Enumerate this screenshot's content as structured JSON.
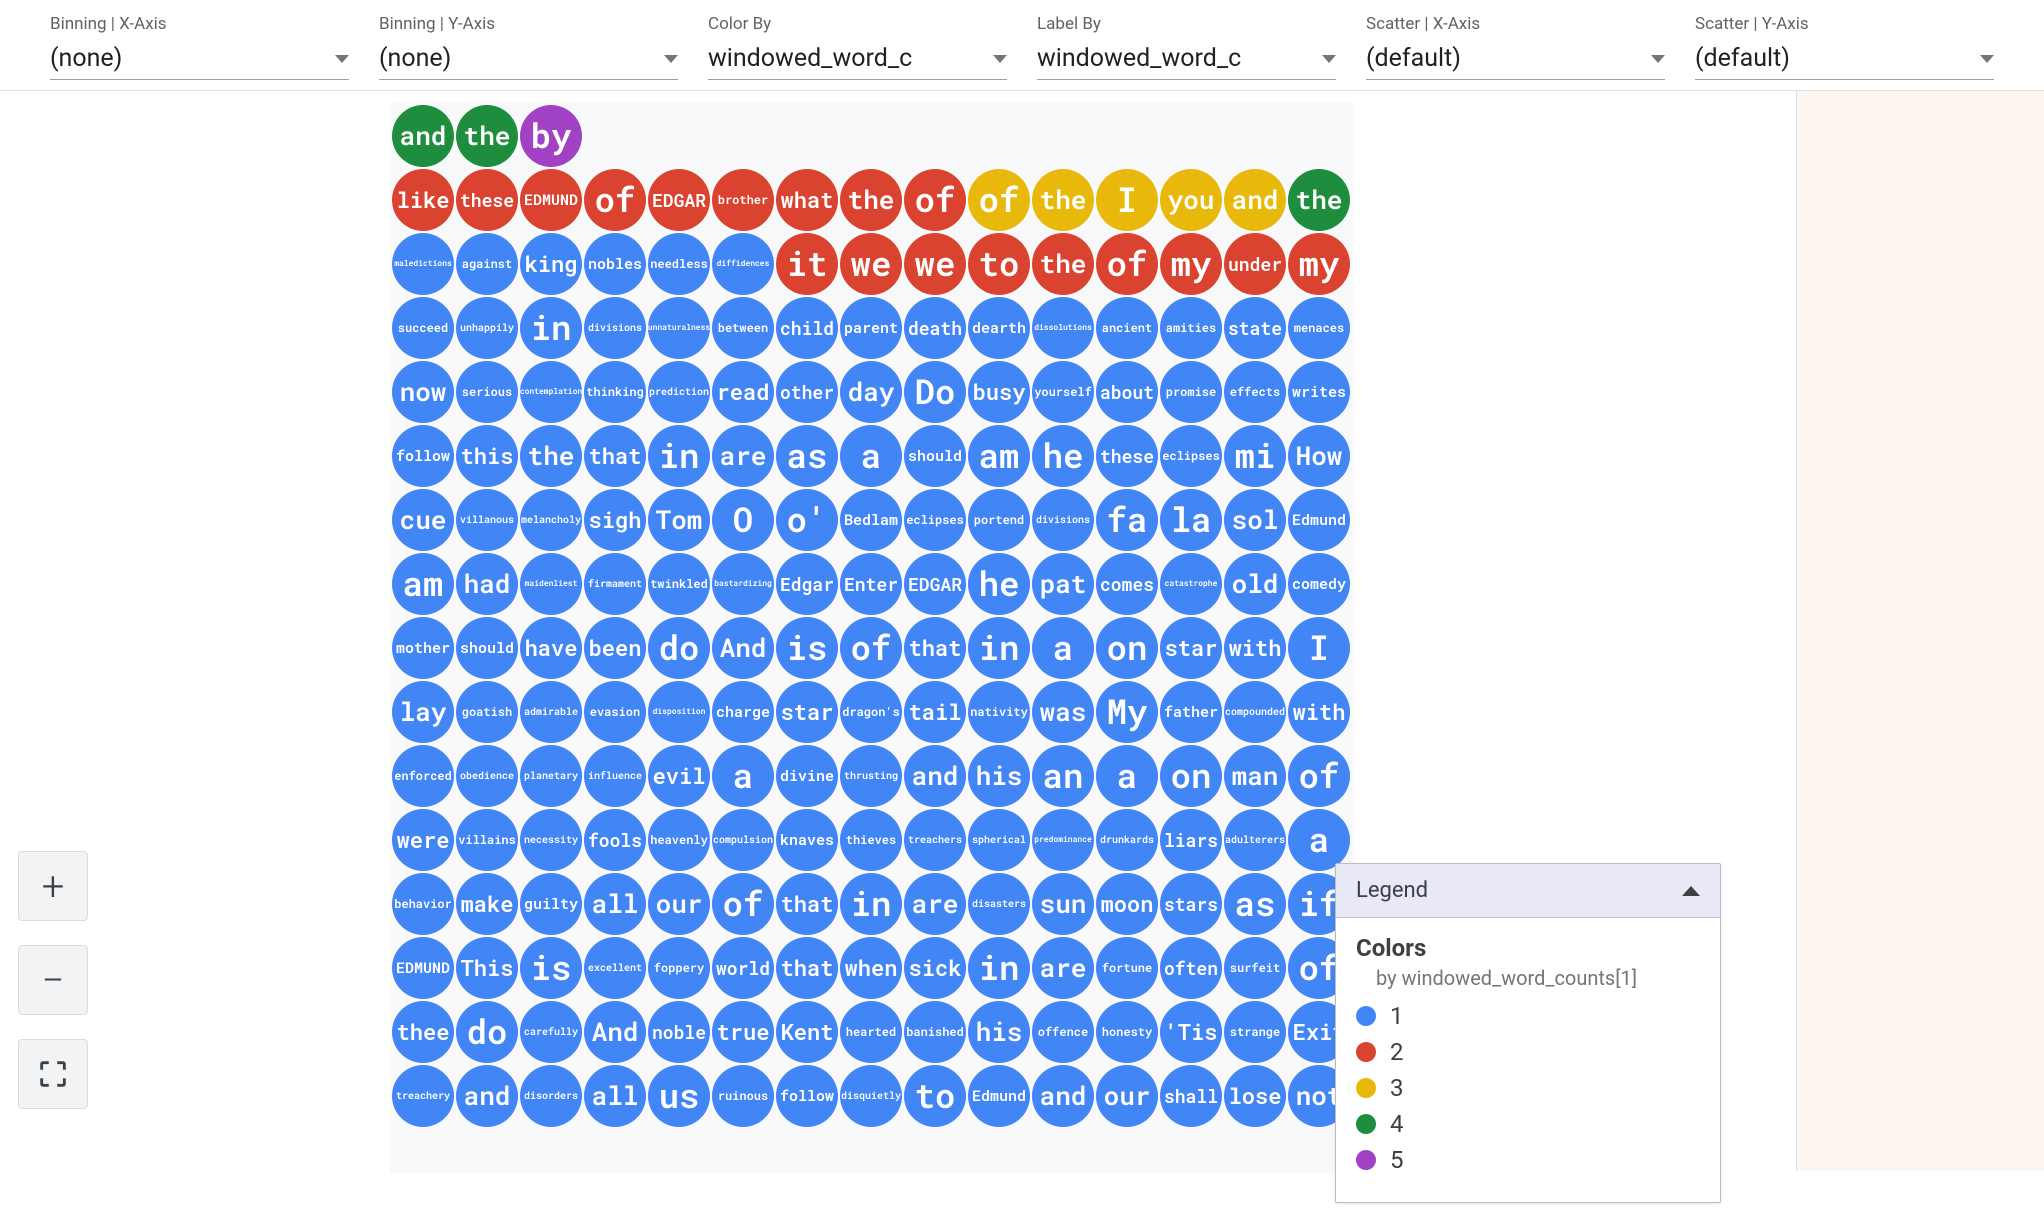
{
  "controls": [
    {
      "label": "Binning | X-Axis",
      "value": "(none)"
    },
    {
      "label": "Binning | Y-Axis",
      "value": "(none)"
    },
    {
      "label": "Color By",
      "value": "windowed_word_c"
    },
    {
      "label": "Label By",
      "value": "windowed_word_c"
    },
    {
      "label": "Scatter | X-Axis",
      "value": "(default)"
    },
    {
      "label": "Scatter | Y-Axis",
      "value": "(default)"
    }
  ],
  "tools": {
    "zoom_in": "+",
    "zoom_out": "−"
  },
  "legend": {
    "header": "Legend",
    "title": "Colors",
    "subtitle": "by windowed_word_counts[1]",
    "items": [
      {
        "color": "#4285f4",
        "label": "1"
      },
      {
        "color": "#d9432f",
        "label": "2"
      },
      {
        "color": "#e8b90b",
        "label": "3"
      },
      {
        "color": "#1e8e3e",
        "label": "4"
      },
      {
        "color": "#a142c4",
        "label": "5"
      }
    ]
  },
  "colors": {
    "1": "#4285f4",
    "2": "#d9432f",
    "3": "#e8b90b",
    "4": "#1e8e3e",
    "5": "#a142c4"
  },
  "grid": {
    "cols": 15,
    "cell": 64,
    "circle": 62,
    "offsetX": 2,
    "offsetY": 2,
    "rows": [
      [
        {
          "t": "and",
          "c": 4
        },
        {
          "t": "the",
          "c": 4
        },
        {
          "t": "by",
          "c": 5
        }
      ],
      [
        {
          "t": "like",
          "c": 2
        },
        {
          "t": "these",
          "c": 2
        },
        {
          "t": "EDMUND",
          "c": 2
        },
        {
          "t": "of",
          "c": 2
        },
        {
          "t": "EDGAR",
          "c": 2
        },
        {
          "t": "brother",
          "c": 2
        },
        {
          "t": "what",
          "c": 2
        },
        {
          "t": "the",
          "c": 2
        },
        {
          "t": "of",
          "c": 2
        },
        {
          "t": "of",
          "c": 3
        },
        {
          "t": "the",
          "c": 3
        },
        {
          "t": "I",
          "c": 3
        },
        {
          "t": "you",
          "c": 3
        },
        {
          "t": "and",
          "c": 3
        },
        {
          "t": "the",
          "c": 4
        }
      ],
      [
        {
          "t": "maledictions",
          "c": 1
        },
        {
          "t": "against",
          "c": 1
        },
        {
          "t": "king",
          "c": 1
        },
        {
          "t": "nobles",
          "c": 1
        },
        {
          "t": "needless",
          "c": 1
        },
        {
          "t": "diffidences",
          "c": 1
        },
        {
          "t": "it",
          "c": 2
        },
        {
          "t": "we",
          "c": 2
        },
        {
          "t": "we",
          "c": 2
        },
        {
          "t": "to",
          "c": 2
        },
        {
          "t": "the",
          "c": 2
        },
        {
          "t": "of",
          "c": 2
        },
        {
          "t": "my",
          "c": 2
        },
        {
          "t": "under",
          "c": 2
        },
        {
          "t": "my",
          "c": 2
        }
      ],
      [
        {
          "t": "succeed",
          "c": 1
        },
        {
          "t": "unhappily",
          "c": 1
        },
        {
          "t": "in",
          "c": 1
        },
        {
          "t": "divisions",
          "c": 1
        },
        {
          "t": "unnaturalness",
          "c": 1
        },
        {
          "t": "between",
          "c": 1
        },
        {
          "t": "child",
          "c": 1
        },
        {
          "t": "parent",
          "c": 1
        },
        {
          "t": "death",
          "c": 1
        },
        {
          "t": "dearth",
          "c": 1
        },
        {
          "t": "dissolutions",
          "c": 1
        },
        {
          "t": "ancient",
          "c": 1
        },
        {
          "t": "amities",
          "c": 1
        },
        {
          "t": "state",
          "c": 1
        },
        {
          "t": "menaces",
          "c": 1
        }
      ],
      [
        {
          "t": "now",
          "c": 1
        },
        {
          "t": "serious",
          "c": 1
        },
        {
          "t": "contemplation",
          "c": 1
        },
        {
          "t": "thinking",
          "c": 1
        },
        {
          "t": "prediction",
          "c": 1
        },
        {
          "t": "read",
          "c": 1
        },
        {
          "t": "other",
          "c": 1
        },
        {
          "t": "day",
          "c": 1
        },
        {
          "t": "Do",
          "c": 1
        },
        {
          "t": "busy",
          "c": 1
        },
        {
          "t": "yourself",
          "c": 1
        },
        {
          "t": "about",
          "c": 1
        },
        {
          "t": "promise",
          "c": 1
        },
        {
          "t": "effects",
          "c": 1
        },
        {
          "t": "writes",
          "c": 1
        }
      ],
      [
        {
          "t": "follow",
          "c": 1
        },
        {
          "t": "this",
          "c": 1
        },
        {
          "t": "the",
          "c": 1
        },
        {
          "t": "that",
          "c": 1
        },
        {
          "t": "in",
          "c": 1
        },
        {
          "t": "are",
          "c": 1
        },
        {
          "t": "as",
          "c": 1
        },
        {
          "t": "a",
          "c": 1
        },
        {
          "t": "should",
          "c": 1
        },
        {
          "t": "am",
          "c": 1
        },
        {
          "t": "he",
          "c": 1
        },
        {
          "t": "these",
          "c": 1
        },
        {
          "t": "eclipses",
          "c": 1
        },
        {
          "t": "mi",
          "c": 1
        },
        {
          "t": "How",
          "c": 1
        }
      ],
      [
        {
          "t": "cue",
          "c": 1
        },
        {
          "t": "villanous",
          "c": 1
        },
        {
          "t": "melancholy",
          "c": 1
        },
        {
          "t": "sigh",
          "c": 1
        },
        {
          "t": "Tom",
          "c": 1
        },
        {
          "t": "O",
          "c": 1
        },
        {
          "t": "o'",
          "c": 1
        },
        {
          "t": "Bedlam",
          "c": 1
        },
        {
          "t": "eclipses",
          "c": 1
        },
        {
          "t": "portend",
          "c": 1
        },
        {
          "t": "divisions",
          "c": 1
        },
        {
          "t": "fa",
          "c": 1
        },
        {
          "t": "la",
          "c": 1
        },
        {
          "t": "sol",
          "c": 1
        },
        {
          "t": "Edmund",
          "c": 1
        }
      ],
      [
        {
          "t": "am",
          "c": 1
        },
        {
          "t": "had",
          "c": 1
        },
        {
          "t": "maidenliest",
          "c": 1
        },
        {
          "t": "firmament",
          "c": 1
        },
        {
          "t": "twinkled",
          "c": 1
        },
        {
          "t": "bastardizing",
          "c": 1
        },
        {
          "t": "Edgar",
          "c": 1
        },
        {
          "t": "Enter",
          "c": 1
        },
        {
          "t": "EDGAR",
          "c": 1
        },
        {
          "t": "he",
          "c": 1
        },
        {
          "t": "pat",
          "c": 1
        },
        {
          "t": "comes",
          "c": 1
        },
        {
          "t": "catastrophe",
          "c": 1
        },
        {
          "t": "old",
          "c": 1
        },
        {
          "t": "comedy",
          "c": 1
        }
      ],
      [
        {
          "t": "mother",
          "c": 1
        },
        {
          "t": "should",
          "c": 1
        },
        {
          "t": "have",
          "c": 1
        },
        {
          "t": "been",
          "c": 1
        },
        {
          "t": "do",
          "c": 1
        },
        {
          "t": "And",
          "c": 1
        },
        {
          "t": "is",
          "c": 1
        },
        {
          "t": "of",
          "c": 1
        },
        {
          "t": "that",
          "c": 1
        },
        {
          "t": "in",
          "c": 1
        },
        {
          "t": "a",
          "c": 1
        },
        {
          "t": "on",
          "c": 1
        },
        {
          "t": "star",
          "c": 1
        },
        {
          "t": "with",
          "c": 1
        },
        {
          "t": "I",
          "c": 1
        }
      ],
      [
        {
          "t": "lay",
          "c": 1
        },
        {
          "t": "goatish",
          "c": 1
        },
        {
          "t": "admirable",
          "c": 1
        },
        {
          "t": "evasion",
          "c": 1
        },
        {
          "t": "disposition",
          "c": 1
        },
        {
          "t": "charge",
          "c": 1
        },
        {
          "t": "star",
          "c": 1
        },
        {
          "t": "dragon's",
          "c": 1
        },
        {
          "t": "tail",
          "c": 1
        },
        {
          "t": "nativity",
          "c": 1
        },
        {
          "t": "was",
          "c": 1
        },
        {
          "t": "My",
          "c": 1
        },
        {
          "t": "father",
          "c": 1
        },
        {
          "t": "compounded",
          "c": 1
        },
        {
          "t": "with",
          "c": 1
        }
      ],
      [
        {
          "t": "enforced",
          "c": 1
        },
        {
          "t": "obedience",
          "c": 1
        },
        {
          "t": "planetary",
          "c": 1
        },
        {
          "t": "influence",
          "c": 1
        },
        {
          "t": "evil",
          "c": 1
        },
        {
          "t": "a",
          "c": 1
        },
        {
          "t": "divine",
          "c": 1
        },
        {
          "t": "thrusting",
          "c": 1
        },
        {
          "t": "and",
          "c": 1
        },
        {
          "t": "his",
          "c": 1
        },
        {
          "t": "an",
          "c": 1
        },
        {
          "t": "a",
          "c": 1
        },
        {
          "t": "on",
          "c": 1
        },
        {
          "t": "man",
          "c": 1
        },
        {
          "t": "of",
          "c": 1
        }
      ],
      [
        {
          "t": "were",
          "c": 1
        },
        {
          "t": "villains",
          "c": 1
        },
        {
          "t": "necessity",
          "c": 1
        },
        {
          "t": "fools",
          "c": 1
        },
        {
          "t": "heavenly",
          "c": 1
        },
        {
          "t": "compulsion",
          "c": 1
        },
        {
          "t": "knaves",
          "c": 1
        },
        {
          "t": "thieves",
          "c": 1
        },
        {
          "t": "treachers",
          "c": 1
        },
        {
          "t": "spherical",
          "c": 1
        },
        {
          "t": "predominance",
          "c": 1
        },
        {
          "t": "drunkards",
          "c": 1
        },
        {
          "t": "liars",
          "c": 1
        },
        {
          "t": "adulterers",
          "c": 1
        },
        {
          "t": "a",
          "c": 1
        }
      ],
      [
        {
          "t": "behavior",
          "c": 1
        },
        {
          "t": "make",
          "c": 1
        },
        {
          "t": "guilty",
          "c": 1
        },
        {
          "t": "all",
          "c": 1
        },
        {
          "t": "our",
          "c": 1
        },
        {
          "t": "of",
          "c": 1
        },
        {
          "t": "that",
          "c": 1
        },
        {
          "t": "in",
          "c": 1
        },
        {
          "t": "are",
          "c": 1
        },
        {
          "t": "disasters",
          "c": 1
        },
        {
          "t": "sun",
          "c": 1
        },
        {
          "t": "moon",
          "c": 1
        },
        {
          "t": "stars",
          "c": 1
        },
        {
          "t": "as",
          "c": 1
        },
        {
          "t": "if",
          "c": 1
        }
      ],
      [
        {
          "t": "EDMUND",
          "c": 1
        },
        {
          "t": "This",
          "c": 1
        },
        {
          "t": "is",
          "c": 1
        },
        {
          "t": "excellent",
          "c": 1
        },
        {
          "t": "foppery",
          "c": 1
        },
        {
          "t": "world",
          "c": 1
        },
        {
          "t": "that",
          "c": 1
        },
        {
          "t": "when",
          "c": 1
        },
        {
          "t": "sick",
          "c": 1
        },
        {
          "t": "in",
          "c": 1
        },
        {
          "t": "are",
          "c": 1
        },
        {
          "t": "fortune",
          "c": 1
        },
        {
          "t": "often",
          "c": 1
        },
        {
          "t": "surfeit",
          "c": 1
        },
        {
          "t": "of",
          "c": 1
        }
      ],
      [
        {
          "t": "thee",
          "c": 1
        },
        {
          "t": "do",
          "c": 1
        },
        {
          "t": "carefully",
          "c": 1
        },
        {
          "t": "And",
          "c": 1
        },
        {
          "t": "noble",
          "c": 1
        },
        {
          "t": "true",
          "c": 1
        },
        {
          "t": "Kent",
          "c": 1
        },
        {
          "t": "hearted",
          "c": 1
        },
        {
          "t": "banished",
          "c": 1
        },
        {
          "t": "his",
          "c": 1
        },
        {
          "t": "offence",
          "c": 1
        },
        {
          "t": "honesty",
          "c": 1
        },
        {
          "t": "'Tis",
          "c": 1
        },
        {
          "t": "strange",
          "c": 1
        },
        {
          "t": "Exit",
          "c": 1
        }
      ],
      [
        {
          "t": "treachery",
          "c": 1
        },
        {
          "t": "and",
          "c": 1
        },
        {
          "t": "disorders",
          "c": 1
        },
        {
          "t": "all",
          "c": 1
        },
        {
          "t": "us",
          "c": 1
        },
        {
          "t": "ruinous",
          "c": 1
        },
        {
          "t": "follow",
          "c": 1
        },
        {
          "t": "disquietly",
          "c": 1
        },
        {
          "t": "to",
          "c": 1
        },
        {
          "t": "Edmund",
          "c": 1
        },
        {
          "t": "and",
          "c": 1
        },
        {
          "t": "our",
          "c": 1
        },
        {
          "t": "shall",
          "c": 1
        },
        {
          "t": "lose",
          "c": 1
        },
        {
          "t": "not",
          "c": 1
        }
      ]
    ]
  }
}
